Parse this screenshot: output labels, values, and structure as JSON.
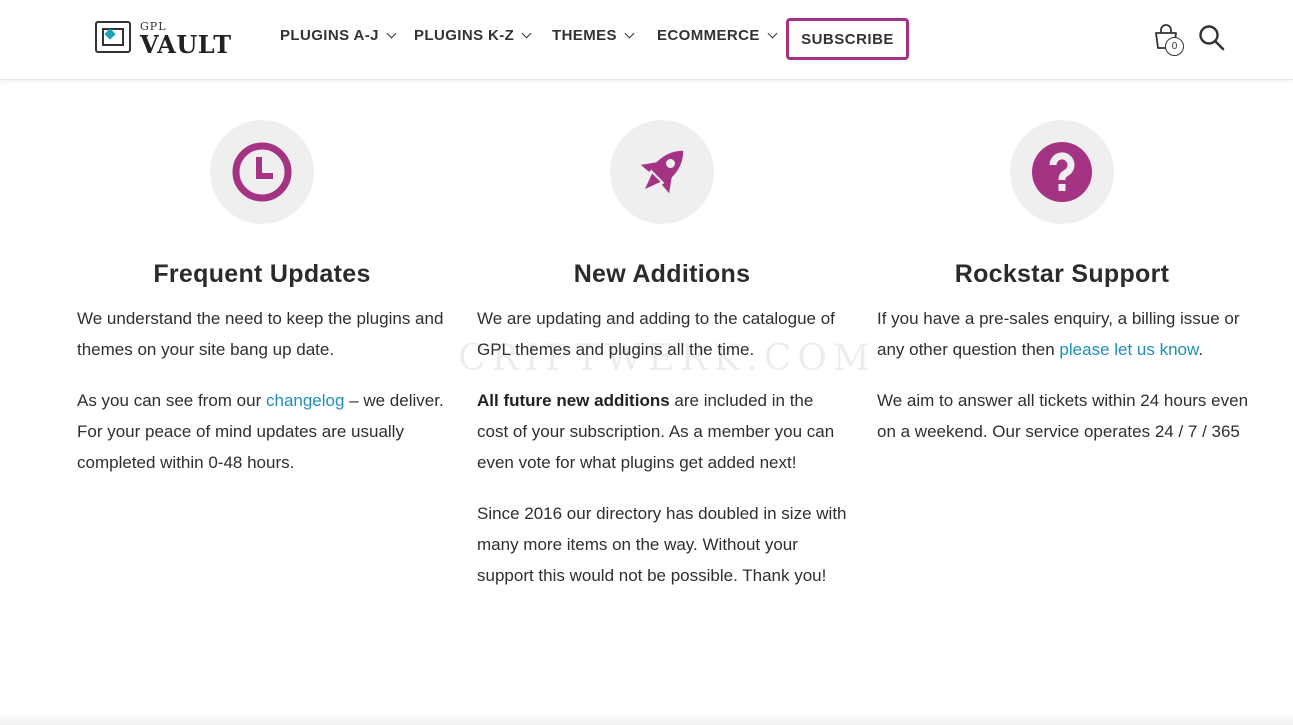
{
  "header": {
    "logo": {
      "small_text": "GPL",
      "main_text": "VAULT"
    },
    "nav": [
      {
        "label": "PLUGINS A-J"
      },
      {
        "label": "PLUGINS K-Z"
      },
      {
        "label": "THEMES"
      },
      {
        "label": "ECOMMERCE"
      }
    ],
    "subscribe_label": "SUBSCRIBE",
    "cart_count": "0"
  },
  "watermark": "CRIPTWERK.COM",
  "features": [
    {
      "icon": "clock-icon",
      "title": "Frequent Updates",
      "p1": "We understand the need to keep the plugins and themes on your site bang up date.",
      "p2_before": "As you can see from our ",
      "p2_link": "changelog",
      "p2_after": " – we deliver. For your peace of mind updates are usually completed within 0-48 hours."
    },
    {
      "icon": "rocket-icon",
      "title": "New Additions",
      "p1": "We are updating and adding to the catalogue of GPL themes and plugins all the time.",
      "p2_bold": "All future new additions",
      "p2_after": " are included in the cost of your subscription. As a member you can even vote for what plugins get added next!",
      "p3": "Since 2016 our directory has doubled in size with many more items on the way. Without your support this would not be possible. Thank you!"
    },
    {
      "icon": "question-icon",
      "title": "Rockstar Support",
      "p1_before": "If you have a pre-sales enquiry, a billing issue or any other question then ",
      "p1_link": "please let us know",
      "p1_after": ".",
      "p2": "We aim to answer all tickets within 24 hours even on a weekend. Our service operates 24 / 7 / 365"
    }
  ],
  "colors": {
    "accent": "#a53384",
    "icon_bg": "#efefef",
    "link": "#1f8fb6"
  }
}
